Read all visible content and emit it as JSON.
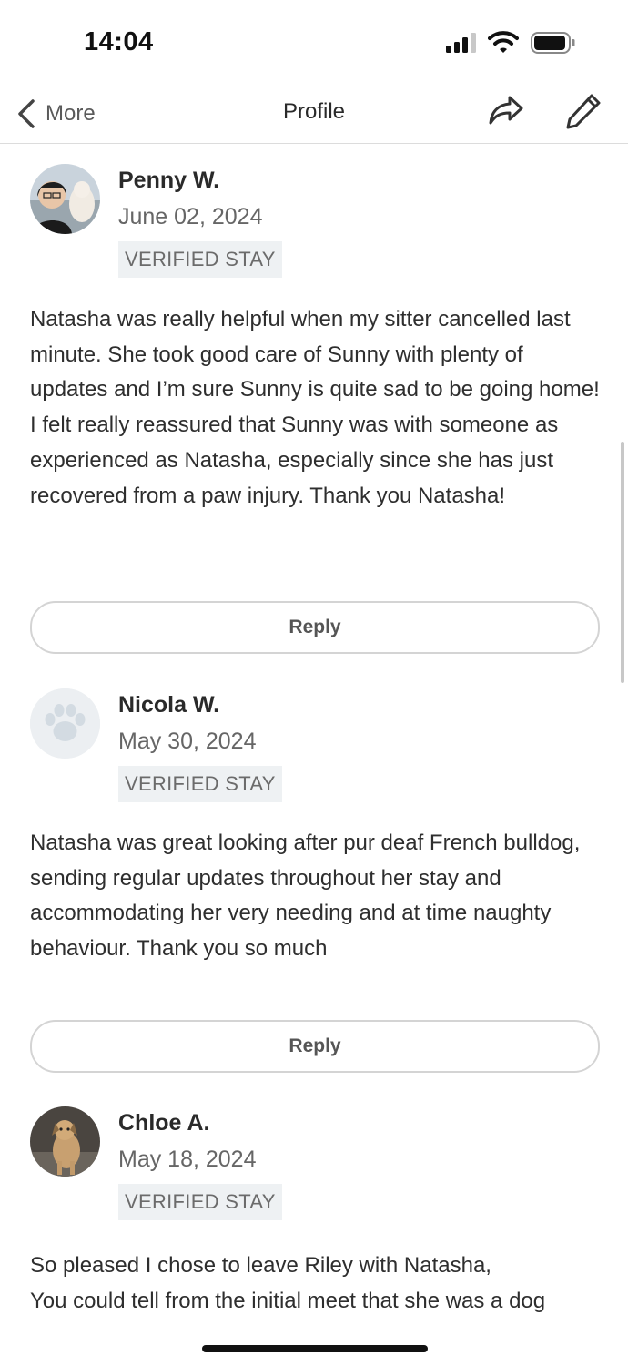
{
  "status_bar": {
    "time": "14:04"
  },
  "nav": {
    "back_label": "More",
    "title": "Profile",
    "share_icon": "share-arrow-icon",
    "edit_icon": "pencil-icon"
  },
  "reviews": [
    {
      "name": "Penny W.",
      "date": "June 02, 2024",
      "badge": "VERIFIED STAY",
      "avatar": "photo",
      "text": "Natasha was really helpful when my sitter cancelled last minute. She took good care of Sunny with plenty of updates and I’m sure Sunny is quite sad to be going home! I felt really reassured that Sunny was with someone as experienced as Natasha, especially since she has just recovered from a paw injury. Thank you Natasha!",
      "reply_label": "Reply"
    },
    {
      "name": "Nicola W.",
      "date": "May 30, 2024",
      "badge": "VERIFIED STAY",
      "avatar": "paw-icon",
      "text": "Natasha was great looking after pur deaf French bulldog, sending regular updates throughout her stay and accommodating her very needing and at time naughty behaviour. Thank you so much",
      "reply_label": "Reply"
    },
    {
      "name": "Chloe A.",
      "date": "May 18, 2024",
      "badge": "VERIFIED STAY",
      "avatar": "photo",
      "text_line1": "So pleased I chose to leave Riley with Natasha,",
      "text_line2": "You could tell from the initial meet that she was a dog"
    }
  ]
}
